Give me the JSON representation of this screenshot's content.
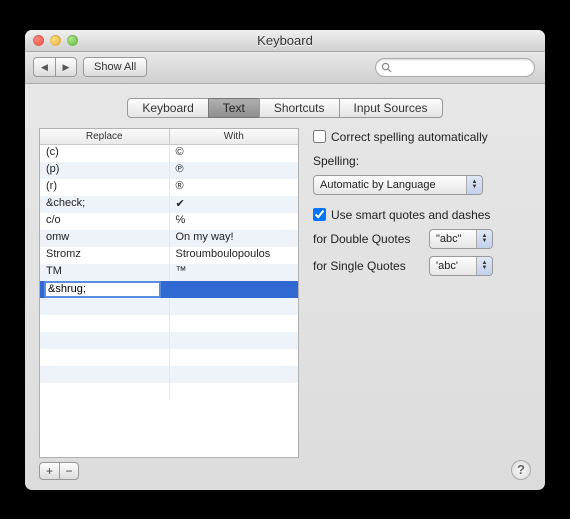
{
  "window": {
    "title": "Keyboard"
  },
  "toolbar": {
    "show_all": "Show All",
    "search_placeholder": ""
  },
  "tabs": [
    "Keyboard",
    "Text",
    "Shortcuts",
    "Input Sources"
  ],
  "active_tab": 1,
  "table": {
    "headers": [
      "Replace",
      "With"
    ],
    "rows": [
      {
        "replace": "(c)",
        "with": "©"
      },
      {
        "replace": "(p)",
        "with": "℗"
      },
      {
        "replace": "(r)",
        "with": "®"
      },
      {
        "replace": "&check;",
        "with": "✔"
      },
      {
        "replace": "c/o",
        "with": "℅"
      },
      {
        "replace": "omw",
        "with": "On my way!"
      },
      {
        "replace": "Stromz",
        "with": "Stroumboulopoulos"
      },
      {
        "replace": "TM",
        "with": "™"
      },
      {
        "replace": "&shrug;",
        "with": "",
        "editing": true
      }
    ]
  },
  "buttons": {
    "add": "+",
    "remove": "−"
  },
  "options": {
    "correct_spelling_label": "Correct spelling automatically",
    "correct_spelling_checked": false,
    "spelling_label": "Spelling:",
    "spelling_value": "Automatic by Language",
    "smart_quotes_label": "Use smart quotes and dashes",
    "smart_quotes_checked": true,
    "double_quotes_label": "for Double Quotes",
    "double_quotes_value": "\"abc\"",
    "single_quotes_label": "for Single Quotes",
    "single_quotes_value": "'abc'"
  },
  "help": "?"
}
